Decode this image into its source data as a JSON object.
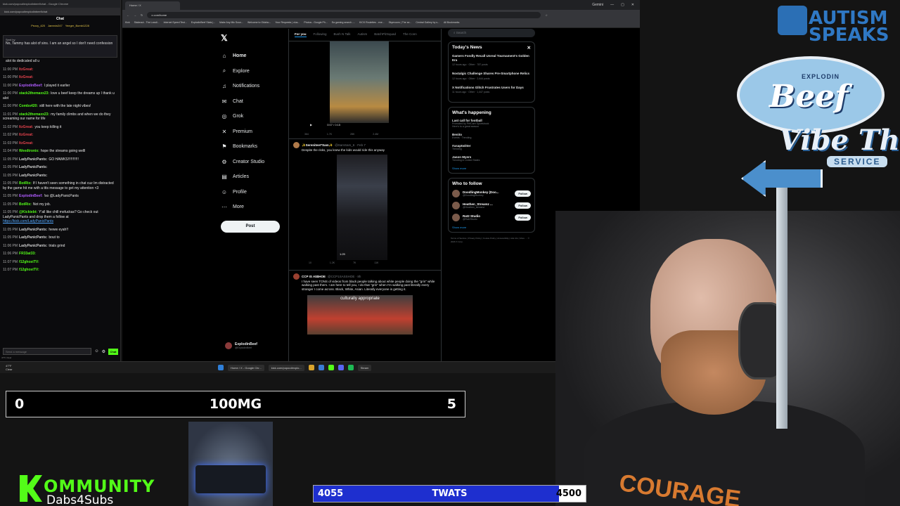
{
  "chat": {
    "window_title": "kick.com/popout/explodinbeef/chat - Google Chrome",
    "url": "kick.com/popout/explodinbeef/chat",
    "header": "Chat",
    "leaders": [
      "Pezzy_420",
      "Jammin247",
      "Yeeger_Bomb1228"
    ],
    "pinned_by": "Sent by",
    "pinned_text": "No, Tammy has alot of sins. I am an angel so I don't need confession",
    "messages": [
      {
        "time": "",
        "user": "",
        "user_color": "#ffffff",
        "text": "alot its dedicated all u"
      },
      {
        "time": "11:00 PM",
        "user": "ItzGreat:",
        "user_color": "#e8434d",
        "text": ""
      },
      {
        "time": "11:00 PM",
        "user": "ItzGreat:",
        "user_color": "#e8434d",
        "text": ""
      },
      {
        "time": "11:00 PM",
        "user": "ExplodinBeef:",
        "user_color": "#b05cff",
        "text": "I played it earlier"
      },
      {
        "time": "11:00 PM",
        "user": "stack2themaxx23:",
        "user_color": "#53fc18",
        "text": "love u beef keep the dreams up I thank u alot"
      },
      {
        "time": "11:00 PM",
        "user": "Combs420:",
        "user_color": "#53fc18",
        "text": "still here with the late night vibes!"
      },
      {
        "time": "11:01 PM",
        "user": "stack2themaxx23:",
        "user_color": "#53fc18",
        "text": "my family climbs and when we do they screaming our name for life"
      },
      {
        "time": "11:02 PM",
        "user": "ItzGreat:",
        "user_color": "#e8434d",
        "text": "you keep killing it"
      },
      {
        "time": "11:02 PM",
        "user": "ItzGreat:",
        "user_color": "#e8434d",
        "text": ""
      },
      {
        "time": "11:03 PM",
        "user": "ItzGreat:",
        "user_color": "#e8434d",
        "text": ""
      },
      {
        "time": "11:04 PM",
        "user": "Weedtronix:",
        "user_color": "#53fc18",
        "text": "hope the streams going welll"
      },
      {
        "time": "11:05 PM",
        "user": "LadyPanicPants:",
        "user_color": "#cfcfcf",
        "text": "GO HAWKS!!!!!!!!!!!"
      },
      {
        "time": "11:05 PM",
        "user": "LadyPanicPants:",
        "user_color": "#cfcfcf",
        "text": ""
      },
      {
        "time": "11:05 PM",
        "user": "LadyPanicPants:",
        "user_color": "#cfcfcf",
        "text": ""
      },
      {
        "time": "11:05 PM",
        "user": "BotRix:",
        "user_color": "#53fc18",
        "text": "If I haven't seen something in chat cuz Im distracted by the game hit me with a ttts message to get my attention <3"
      },
      {
        "time": "11:05 PM",
        "user": "ExplodinBeef:",
        "user_color": "#b05cff",
        "text": "!so @LadyPanicPants"
      },
      {
        "time": "11:05 PM",
        "user": "BotRix:",
        "user_color": "#53fc18",
        "text": "Not my job."
      },
      {
        "time": "11:05 PM",
        "user": "@Kickiebt:",
        "user_color": "#53fc18",
        "text": "Y'all like chill mofuckas? Go check out LadyPanicPants and drop them a follow at",
        "link": "https://kick.com/LadyPanicPants"
      },
      {
        "time": "11:05 PM",
        "user": "LadyPanicPants:",
        "user_color": "#cfcfcf",
        "text": "heww eyah!!"
      },
      {
        "time": "11:05 PM",
        "user": "LadyPanicPants:",
        "user_color": "#cfcfcf",
        "text": "bout to"
      },
      {
        "time": "11:06 PM",
        "user": "LadyPanicPants:",
        "user_color": "#cfcfcf",
        "text": "trials grind"
      },
      {
        "time": "11:06 PM",
        "user": "FR33at33:",
        "user_color": "#53fc18",
        "text": ""
      },
      {
        "time": "11:07 PM",
        "user": "f12ghostTV:",
        "user_color": "#53fc18",
        "text": ""
      },
      {
        "time": "11:07 PM",
        "user": "f12ghostTV:",
        "user_color": "#53fc18",
        "text": ""
      }
    ],
    "input_placeholder": "Send a message",
    "send_label": "Chat",
    "status": "47°F Clear"
  },
  "browser": {
    "tab_title": "Home / X",
    "url": "x.com/home",
    "bookmarks": [
      "Kick",
      "Stakeout - The Lowdi...",
      "Internet Speed Test...",
      "ExplodinBeef Stats |...",
      "Make Any Mic Soun...",
      "Welcome to Oklaho...",
      "Your Requests | clus...",
      "Photos - Google Ph...",
      "Ea gaming search -...",
      "KICK Roulettes - exe...",
      "Skymoons | The se...",
      "Central Gallery by s...",
      "All Bookmarks"
    ],
    "window_badge": "Gemini"
  },
  "xnav": {
    "items": [
      {
        "label": "Home",
        "icon": "⌂"
      },
      {
        "label": "Explore",
        "icon": "⌕"
      },
      {
        "label": "Notifications",
        "icon": "♫"
      },
      {
        "label": "Chat",
        "icon": "✉"
      },
      {
        "label": "Grok",
        "icon": "◎"
      },
      {
        "label": "Premium",
        "icon": "✕"
      },
      {
        "label": "Bookmarks",
        "icon": "⚑"
      },
      {
        "label": "Creator Studio",
        "icon": "⚙"
      },
      {
        "label": "Articles",
        "icon": "▤"
      },
      {
        "label": "Profile",
        "icon": "☺"
      },
      {
        "label": "More",
        "icon": "⋯"
      }
    ],
    "post_label": "Post",
    "account_name": "ExplodinBeef",
    "account_handle": "@ExplodinBeef"
  },
  "feed": {
    "tabs": [
      "For you",
      "Following",
      "Bush N Talk",
      "Autism",
      "BatchPlzSquad",
      "The Conn"
    ],
    "video1_time": "0:07 / 0:15",
    "post1_actions": [
      "364",
      "1.7K",
      "28K",
      "2.4M"
    ],
    "post2_name": "✨Serenitee!*Sam✨",
    "post2_handle": "@SamSam_6 · Feb 7",
    "post2_text": "Despite the risks, you knew the kids would ride this anyway",
    "post2_duration": "1:29",
    "post2_actions": [
      "10",
      "1.2K",
      "7K",
      "11K"
    ],
    "post3_name": "CCP IS A$$HOE",
    "post3_handle": "@CCP1SASSHOE · 8h",
    "post3_text": "I have seen TONS of videos from black people talking about white people doing the \"grin\" while walking past them. I am here to tell you, I do that \"grin\" when I'm walking past literally every stranger I come across. Black, White, Asian. Literally everyone is getting it.",
    "post3_caption": "culturally appropriate"
  },
  "xright": {
    "search_placeholder": "Search",
    "news_title": "Today's News",
    "news": [
      {
        "title": "Gamers Fondly Recall Unreal Tournament's Golden Era",
        "meta": "12 hours ago · Other · 787 posts"
      },
      {
        "title": "Nostalgic Challenge Shares Pre-Smartphone Relics",
        "meta": "12 hours ago · Other · 2,644 posts"
      },
      {
        "title": "X Notifications Glitch Frustrates Users for Days",
        "meta": "11 hours ago · Other · 1,447 posts"
      }
    ],
    "trending_title": "What's happening",
    "trends": [
      {
        "ctx": "Promoted by PetCare Sportsbook",
        "name": "Last call for football",
        "sub": "Here's to a great season"
      },
      {
        "ctx": "Events · Trending",
        "name": "Benito",
        "sub": ""
      },
      {
        "ctx": "Trending",
        "name": "#usaptwitter",
        "sub": ""
      },
      {
        "ctx": "Trending in United States",
        "name": "Jason Myers",
        "sub": ""
      }
    ],
    "show_more": "Show more",
    "follow_title": "Who to follow",
    "follows": [
      {
        "name": "DoodlingMonkey (Doo...",
        "handle": "@DoodlingMonkey"
      },
      {
        "name": "Heathen_Streamz ...",
        "handle": "@Heathen_streamz"
      },
      {
        "name": "Rat2 Studio",
        "handle": "@Rat2Studio"
      }
    ],
    "follow_label": "Follow",
    "footer": "Terms of Service | Privacy Policy | Cookie Policy | Accessibility | Ads info | More ··· © 2026 X Corp."
  },
  "taskbar": {
    "weather_temp": "47°F",
    "weather_desc": "Clear",
    "apps": [
      "Home / X - Google Chr...",
      "kick.com/popout/explo...",
      "Steam"
    ],
    "time": "11:08 PM",
    "date": "2/8/2026"
  },
  "overlay": {
    "autism_text_1": "AUTISM",
    "autism_text_2": "SPEAKS",
    "beef_top": "EXPLODIN",
    "beef_word": "Beef",
    "vibe_text": "Vibe Thru",
    "service_text": "SERVICE",
    "score_left": "0",
    "score_title": "100MG",
    "score_right": "5",
    "kommunity_word": "OMMUNITY",
    "kommunity_sub": "Dabs4Subs",
    "goal_current": "4055",
    "goal_label": "TWATS",
    "goal_target": "4500",
    "goal_fraction": 0.901,
    "shirt_print": "COURAGE"
  }
}
